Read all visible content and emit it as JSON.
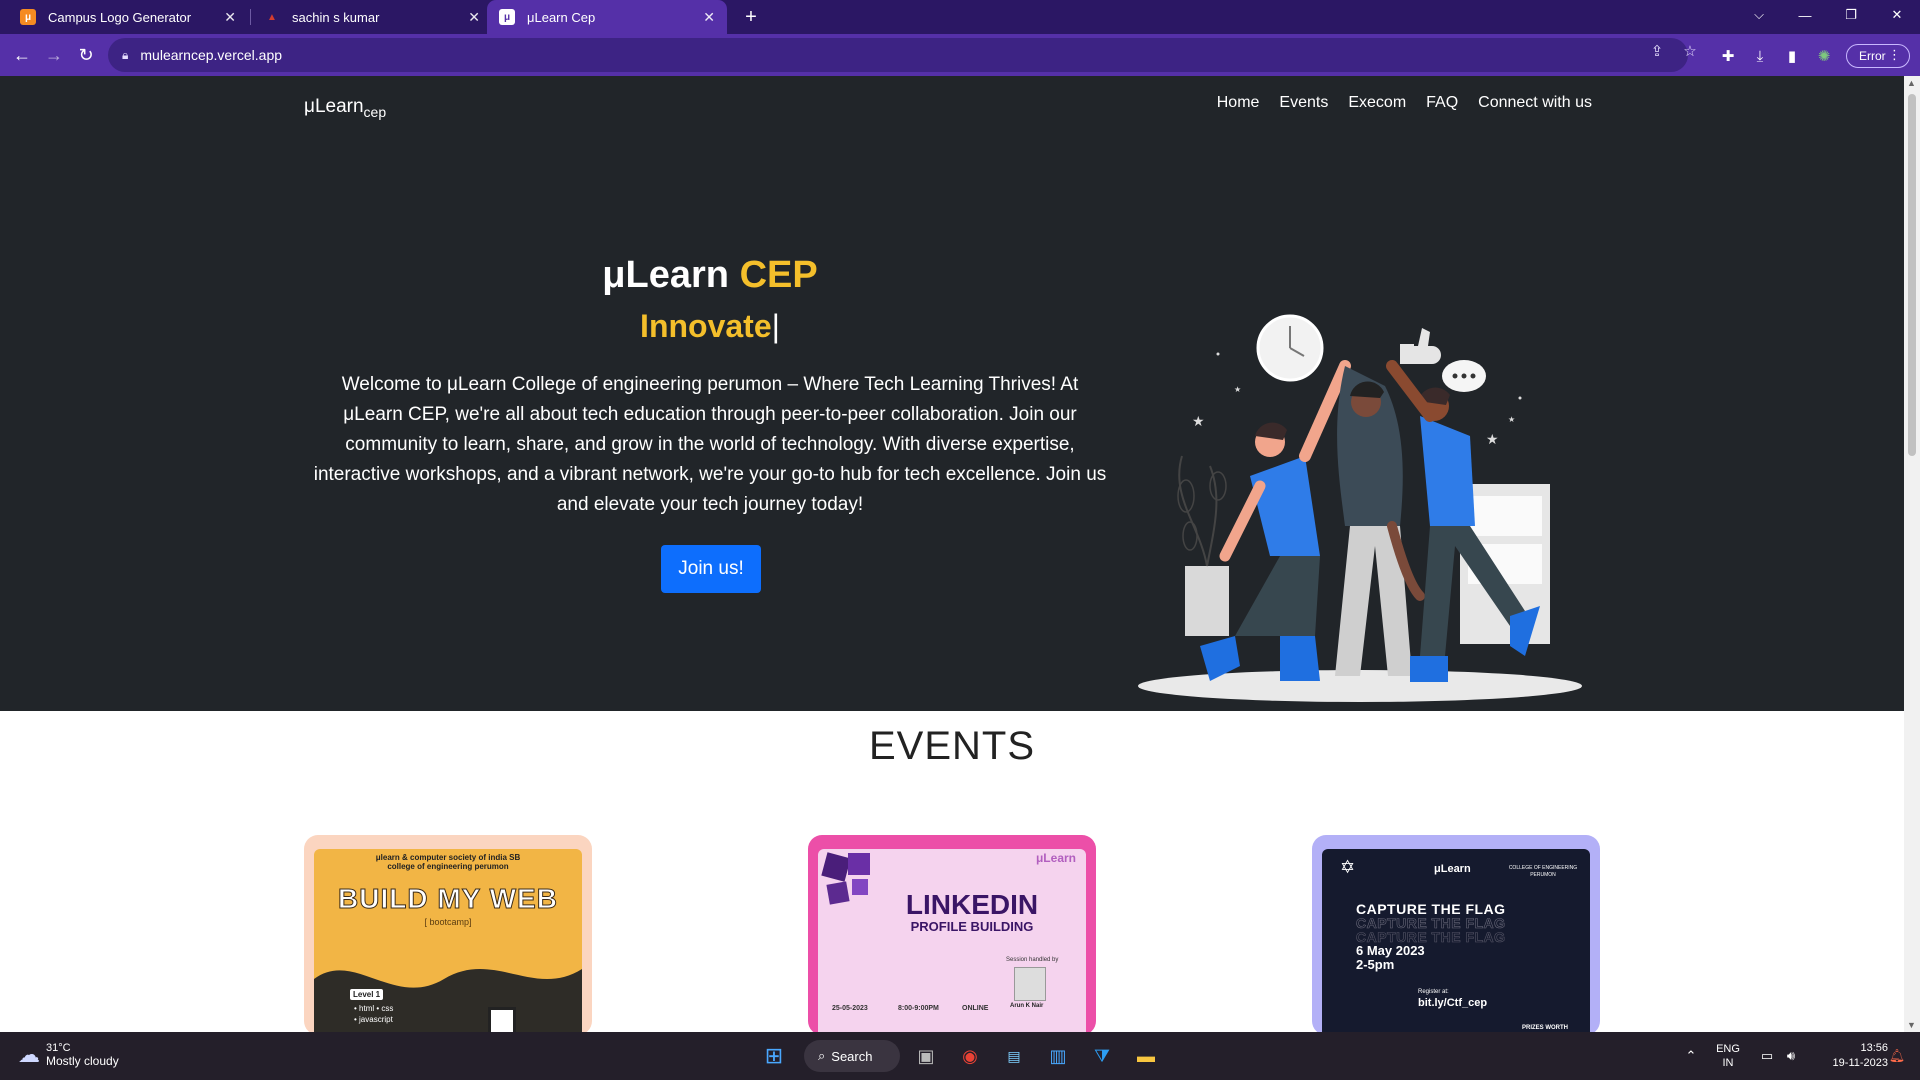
{
  "browser": {
    "tabs": [
      {
        "title": "Campus Logo Generator",
        "favicon": "μ",
        "favicon_color": "#f58b22",
        "active": false
      },
      {
        "title": "sachin s kumar",
        "favicon": "▲",
        "favicon_color": "#d43c2f",
        "active": false
      },
      {
        "title": "μLearn Cep",
        "favicon": "μ",
        "favicon_color": "#ffffff",
        "active": true
      }
    ],
    "new_tab_icon": "+",
    "url": "mulearncep.vercel.app",
    "profile_status": "Error",
    "window_controls": [
      "⌵",
      "—",
      "❐",
      "✕"
    ]
  },
  "site": {
    "brand": "μLearn",
    "brand_sub": "cep",
    "nav": [
      "Home",
      "Events",
      "Execom",
      "FAQ",
      "Connect with us"
    ],
    "hero": {
      "title_main": "μLearn ",
      "title_accent": "CEP",
      "typed_word": "Innovate",
      "caret": "|",
      "description": "Welcome to μLearn College of engineering perumon – Where Tech Learning Thrives! At μLearn CEP, we're all about tech education through peer-to-peer collaboration. Join our community to learn, share, and grow in the world of technology. With diverse expertise, interactive workshops, and a vibrant network, we're your go-to hub for tech excellence. Join us and elevate your tech journey today!",
      "cta": "Join us!"
    },
    "events_heading": "EVENTS",
    "events": [
      {
        "header": "μlearn & computer society of india SB",
        "header2": "college of engineering perumon",
        "title": "BUILD MY WEB",
        "subtitle": "[ bootcamp]",
        "level": "Level 1",
        "items": [
          "• html • css",
          "• javascript"
        ],
        "card_bg": "#fbd5c0",
        "poster_bg": "#f2b545"
      },
      {
        "brand": "μLearn",
        "title": "LINKEDIN",
        "subtitle": "PROFILE BUILDING",
        "session": "Session handled by",
        "speaker": "Arun K Nair",
        "date": "25-05-2023",
        "time": "8:00-9:00PM",
        "mode": "ONLINE",
        "card_bg": "#ec4fa8",
        "poster_bg": "#f5d3ee"
      },
      {
        "brand": "μLearn",
        "college": "COLLEGE OF ENGINEERING PERUMON",
        "title": "CAPTURE THE FLAG",
        "date": "6 May 2023",
        "time": "2-5pm",
        "register": "Register at:",
        "link": "bit.ly/Ctf_cep",
        "prizes": "PRIZES WORTH",
        "card_bg": "#b3b0f7",
        "poster_bg": "#151a2e"
      }
    ]
  },
  "taskbar": {
    "temp": "31°C",
    "weather": "Mostly cloudy",
    "search": "Search",
    "lang": "ENG",
    "region": "IN",
    "time": "13:56",
    "date": "19-11-2023"
  }
}
